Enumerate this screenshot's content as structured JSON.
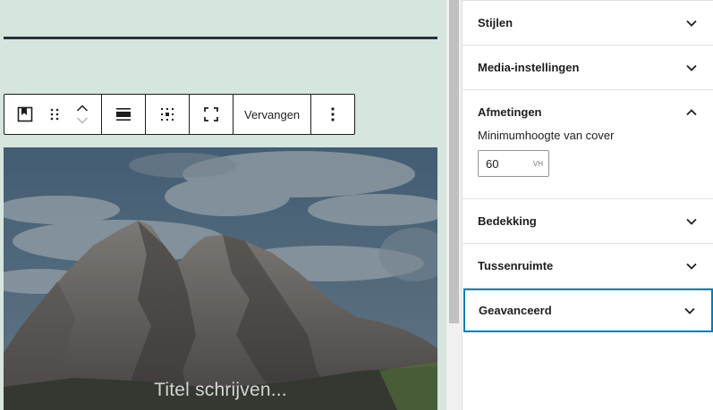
{
  "toolbar": {
    "replace_label": "Vervangen"
  },
  "cover": {
    "title_placeholder": "Titel schrijven..."
  },
  "sidebar": {
    "panels": [
      {
        "title": "Stijlen",
        "expanded": false
      },
      {
        "title": "Media-instellingen",
        "expanded": false
      },
      {
        "title": "Afmetingen",
        "expanded": true
      },
      {
        "title": "Bedekking",
        "expanded": false
      },
      {
        "title": "Tussenruimte",
        "expanded": false
      },
      {
        "title": "Geavanceerd",
        "expanded": false,
        "focused": true
      }
    ],
    "dimensions": {
      "min_height_label": "Minimumhoogte van cover",
      "min_height_value": "60",
      "min_height_unit": "VH"
    }
  },
  "colors": {
    "canvas_bg": "#d6e5de",
    "separator": "#29323a",
    "focus": "#007cba"
  }
}
